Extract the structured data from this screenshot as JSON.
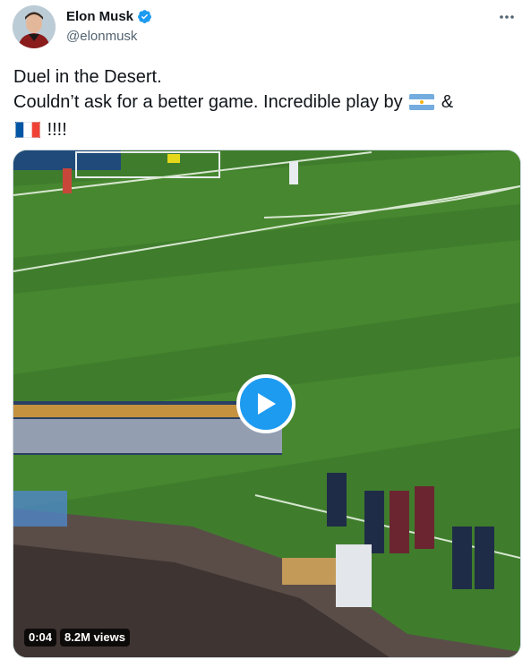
{
  "author": {
    "display_name": "Elon Musk",
    "handle": "@elonmusk",
    "verified": true
  },
  "icons": {
    "verified": "verified-badge-icon",
    "more": "more-options-icon",
    "play": "play-icon",
    "flag_argentina": "argentina-flag-icon",
    "flag_france": "france-flag-icon"
  },
  "tweet": {
    "line1": "Duel in the Desert.",
    "line2_text": "Couldn’t ask for a better game. Incredible play by",
    "line2_amp": "&",
    "line3_text": "!!!!"
  },
  "video": {
    "duration": "0:04",
    "views": "8.2M views",
    "accent_color": "#1d9bf0"
  },
  "colors": {
    "text_primary": "#0f1419",
    "text_secondary": "#536471",
    "border": "#cfd9de"
  }
}
